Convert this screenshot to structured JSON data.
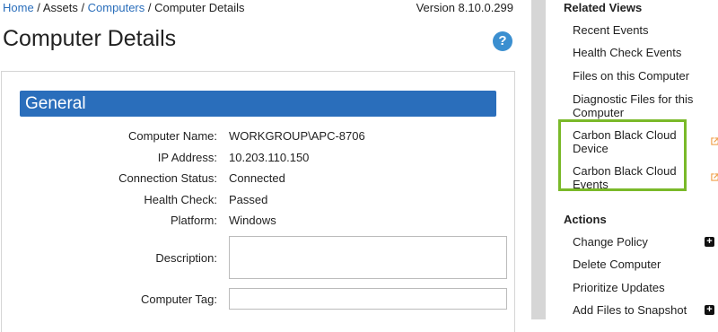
{
  "breadcrumb": {
    "home": "Home",
    "sep1": " / ",
    "assets": "Assets",
    "sep2": " / ",
    "computers": "Computers",
    "sep3": " / ",
    "current": "Computer Details"
  },
  "version": "Version 8.10.0.299",
  "page_title": "Computer Details",
  "help_icon_text": "?",
  "general": {
    "header": "General",
    "fields": {
      "computer_name": {
        "label": "Computer Name:",
        "value": "WORKGROUP\\APC-8706"
      },
      "ip_address": {
        "label": "IP Address:",
        "value": "10.203.110.150"
      },
      "connection_status": {
        "label": "Connection Status:",
        "value": "Connected"
      },
      "health_check": {
        "label": "Health Check:",
        "value": "Passed"
      },
      "platform": {
        "label": "Platform:",
        "value": "Windows"
      },
      "description": {
        "label": "Description:",
        "value": ""
      },
      "computer_tag": {
        "label": "Computer Tag:",
        "value": ""
      }
    }
  },
  "sidebar": {
    "related_views_heading": "Related Views",
    "related_views": [
      "Recent Events",
      "Health Check Events",
      "Files on this Computer",
      "Diagnostic Files for this Computer",
      "Carbon Black Cloud Device",
      "Carbon Black Cloud Events"
    ],
    "actions_heading": "Actions",
    "actions": [
      "Change Policy",
      "Delete Computer",
      "Prioritize Updates",
      "Add Files to Snapshot"
    ],
    "highlight_color": "#7ab929",
    "link_color": "#2a6ebb",
    "external_icon_color": "#f0a04b"
  }
}
